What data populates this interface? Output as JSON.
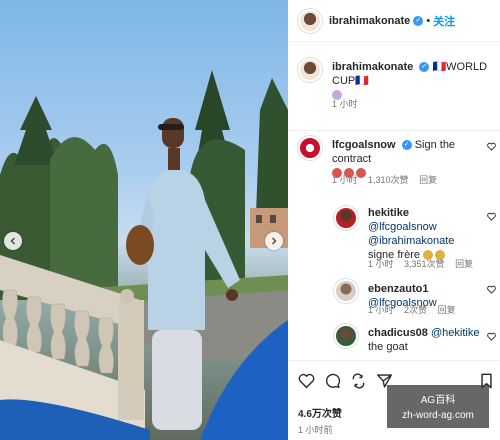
{
  "post": {
    "author": "ibrahimakonate",
    "follow_label": "关注",
    "caption_user": "ibrahimakonate",
    "caption_text": "🇫🇷WORLD CUP🇫🇷",
    "caption_time": "1 小时"
  },
  "comments": [
    {
      "user": "lfcgoalsnow",
      "text": "Sign the contract",
      "time": "1 小时",
      "likes": "1,310次赞",
      "reply": "回复"
    },
    {
      "user": "hekitike",
      "mention1": "@lfcgoalsnow",
      "mention2": "@ibrahimakonate",
      "text": "signe frère",
      "time": "1 小时",
      "likes": "3,351次赞",
      "reply": "回复"
    },
    {
      "user": "ebenzauto1",
      "mention": "@lfcgoalsnow",
      "time": "1 小时",
      "likes": "2次赞",
      "reply": "回复"
    },
    {
      "user": "chadicus08",
      "mention": "@hekitike",
      "text": "the goat"
    }
  ],
  "footer": {
    "likes": "4.6万次赞",
    "time": "1 小时前"
  },
  "watermark": {
    "line1": "AG百科",
    "line2": "zh-word-ag.com"
  },
  "colors": {
    "accent": "#0095f6",
    "mention": "#00376b",
    "verified": "#3897f0"
  }
}
